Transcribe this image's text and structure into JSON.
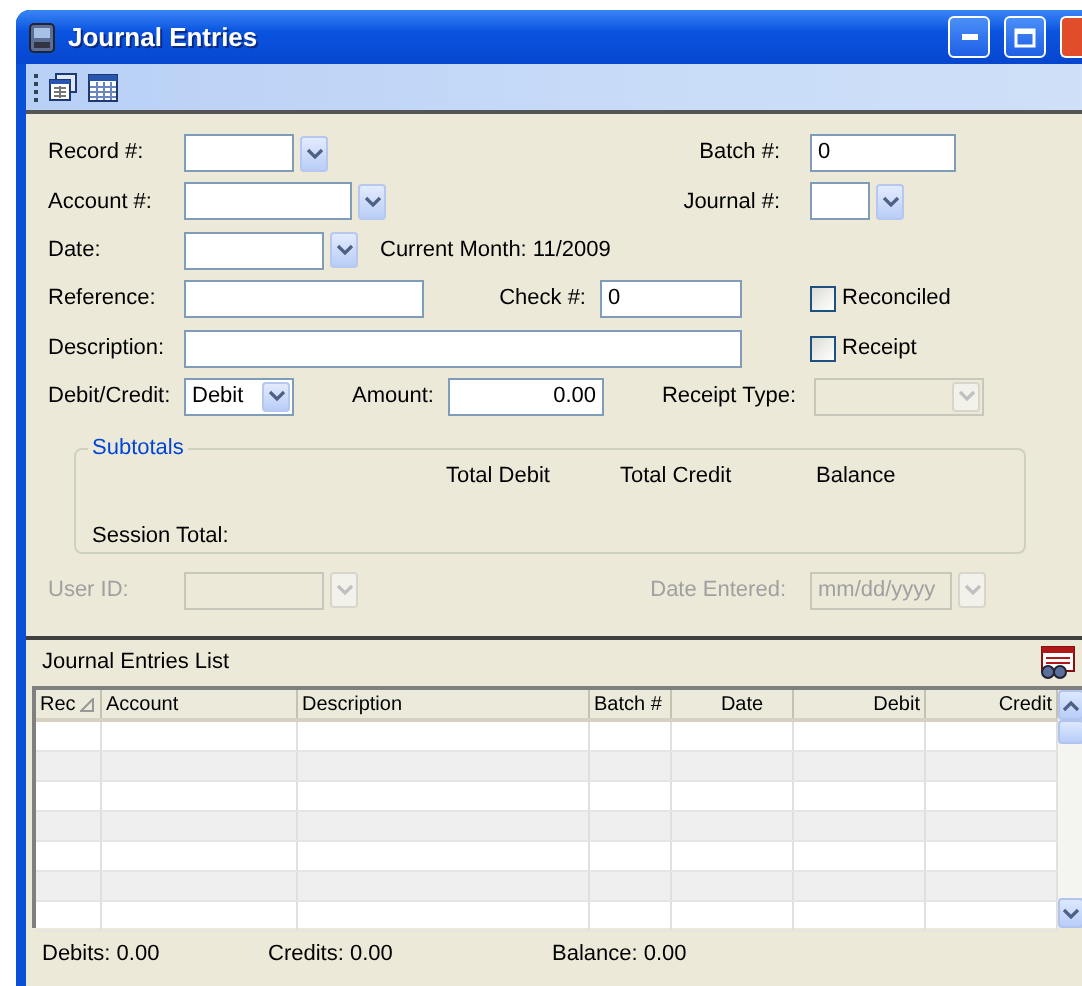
{
  "window": {
    "title": "Journal Entries"
  },
  "form_rows": [
    [
      {
        "kind": "label",
        "text": "Record #:",
        "disabled": false
      },
      {
        "kind": "picker",
        "disabled": false
      },
      {
        "kind": "label",
        "text": "Batch #:",
        "disabled": false
      },
      {
        "kind": "text",
        "value": "0",
        "disabled": false
      }
    ],
    [
      {
        "kind": "label",
        "text": "Account #:",
        "disabled": false
      },
      {
        "kind": "picker",
        "disabled": false
      },
      {
        "kind": "label",
        "text": "Journal #:",
        "disabled": false
      },
      {
        "kind": "picker",
        "disabled": false
      }
    ],
    [
      {
        "kind": "label",
        "text": "Date:",
        "disabled": false
      },
      {
        "kind": "picker",
        "disabled": false
      },
      {
        "kind": "label",
        "text": "Current Month: 11/2009",
        "disabled": false
      }
    ],
    [
      {
        "kind": "label",
        "text": "Reference:",
        "disabled": false
      },
      {
        "kind": "text",
        "disabled": false
      },
      {
        "kind": "label",
        "text": "Check #:",
        "disabled": false
      },
      {
        "kind": "text",
        "value": "0",
        "disabled": false
      },
      {
        "kind": "checkbox",
        "text": "Reconciled",
        "checked": false
      }
    ],
    [
      {
        "kind": "label",
        "text": "Description:",
        "disabled": false
      },
      {
        "kind": "text",
        "disabled": false
      },
      {
        "kind": "checkbox",
        "text": "Receipt",
        "checked": false
      }
    ],
    [
      {
        "kind": "label",
        "text": "Debit/Credit:",
        "disabled": false
      },
      {
        "kind": "select",
        "value": "Debit",
        "disabled": false
      },
      {
        "kind": "label",
        "text": "Amount:",
        "disabled": false
      },
      {
        "kind": "number",
        "value": "0.00",
        "disabled": false
      },
      {
        "kind": "label",
        "text": "Receipt Type:",
        "disabled": false
      },
      {
        "kind": "select",
        "disabled": true
      }
    ]
  ],
  "subtotals": {
    "title": "Subtotals",
    "columns": [
      "Total Debit",
      "Total Credit",
      "Balance"
    ],
    "row_label": "Session Total:"
  },
  "footer_row": [
    {
      "kind": "label",
      "text": "User ID:",
      "disabled": true
    },
    {
      "kind": "picker",
      "disabled": true
    },
    {
      "kind": "label",
      "text": "Date Entered:",
      "disabled": true
    },
    {
      "kind": "picker",
      "placeholder": "mm/dd/yyyy",
      "disabled": true
    }
  ],
  "list": {
    "title": "Journal Entries List",
    "columns": [
      {
        "label": "Rec",
        "sorted": true
      },
      {
        "label": "Account",
        "sorted": false
      },
      {
        "label": "Description",
        "sorted": false
      },
      {
        "label": "Batch #",
        "sorted": false
      },
      {
        "label": "Date",
        "sorted": false
      },
      {
        "label": "Debit",
        "sorted": false
      },
      {
        "label": "Credit",
        "sorted": false
      }
    ]
  },
  "status_bar": [
    {
      "label": "Debits:",
      "value": "0.00"
    },
    {
      "label": "Credits:",
      "value": "0.00"
    },
    {
      "label": "Balance:",
      "value": "0.00"
    }
  ]
}
